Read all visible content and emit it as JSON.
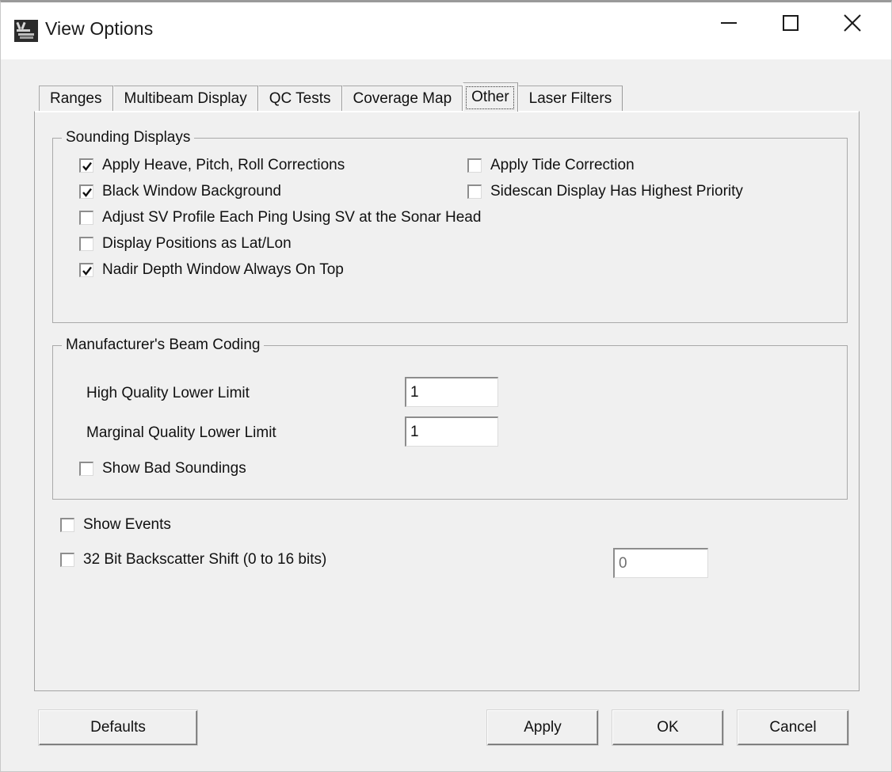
{
  "window": {
    "title": "View Options",
    "icon": "app-icon",
    "controls": {
      "minimize": "minimize-icon",
      "maximize": "maximize-icon",
      "close": "close-icon"
    }
  },
  "tabs": [
    {
      "label": "Ranges",
      "selected": false
    },
    {
      "label": "Multibeam Display",
      "selected": false
    },
    {
      "label": "QC Tests",
      "selected": false
    },
    {
      "label": "Coverage Map",
      "selected": false
    },
    {
      "label": "Other",
      "selected": true
    },
    {
      "label": "Laser Filters",
      "selected": false
    }
  ],
  "groups": {
    "sounding_displays": {
      "title": "Sounding Displays",
      "left_column": [
        {
          "label": "Apply Heave, Pitch, Roll Corrections",
          "checked": true
        },
        {
          "label": "Black Window Background",
          "checked": true
        },
        {
          "label": "Adjust SV Profile Each Ping Using SV at the Sonar Head",
          "checked": false
        },
        {
          "label": "Display Positions as Lat/Lon",
          "checked": false
        },
        {
          "label": "Nadir Depth Window Always On Top",
          "checked": true
        }
      ],
      "right_column": [
        {
          "label": "Apply Tide Correction",
          "checked": false
        },
        {
          "label": "Sidescan Display Has Highest Priority",
          "checked": false
        }
      ]
    },
    "beam_coding": {
      "title": "Manufacturer's Beam Coding",
      "fields": [
        {
          "label": "High Quality Lower Limit",
          "value": "1"
        },
        {
          "label": "Marginal Quality Lower Limit",
          "value": "1"
        }
      ],
      "checkbox": {
        "label": "Show Bad Soundings",
        "checked": false
      }
    }
  },
  "standalone_options": [
    {
      "label": "Show Events",
      "checked": false
    },
    {
      "label": "32 Bit Backscatter Shift (0 to 16 bits)",
      "checked": false
    }
  ],
  "backscatter_field": {
    "value": "0"
  },
  "buttons": {
    "defaults": "Defaults",
    "apply": "Apply",
    "ok": "OK",
    "cancel": "Cancel"
  },
  "colors": {
    "dialog_bg": "#f0f0f0",
    "titlebar_bg": "#ffffff",
    "text": "#111111",
    "border": "#a9a9a9",
    "field_bg": "#ffffff"
  }
}
